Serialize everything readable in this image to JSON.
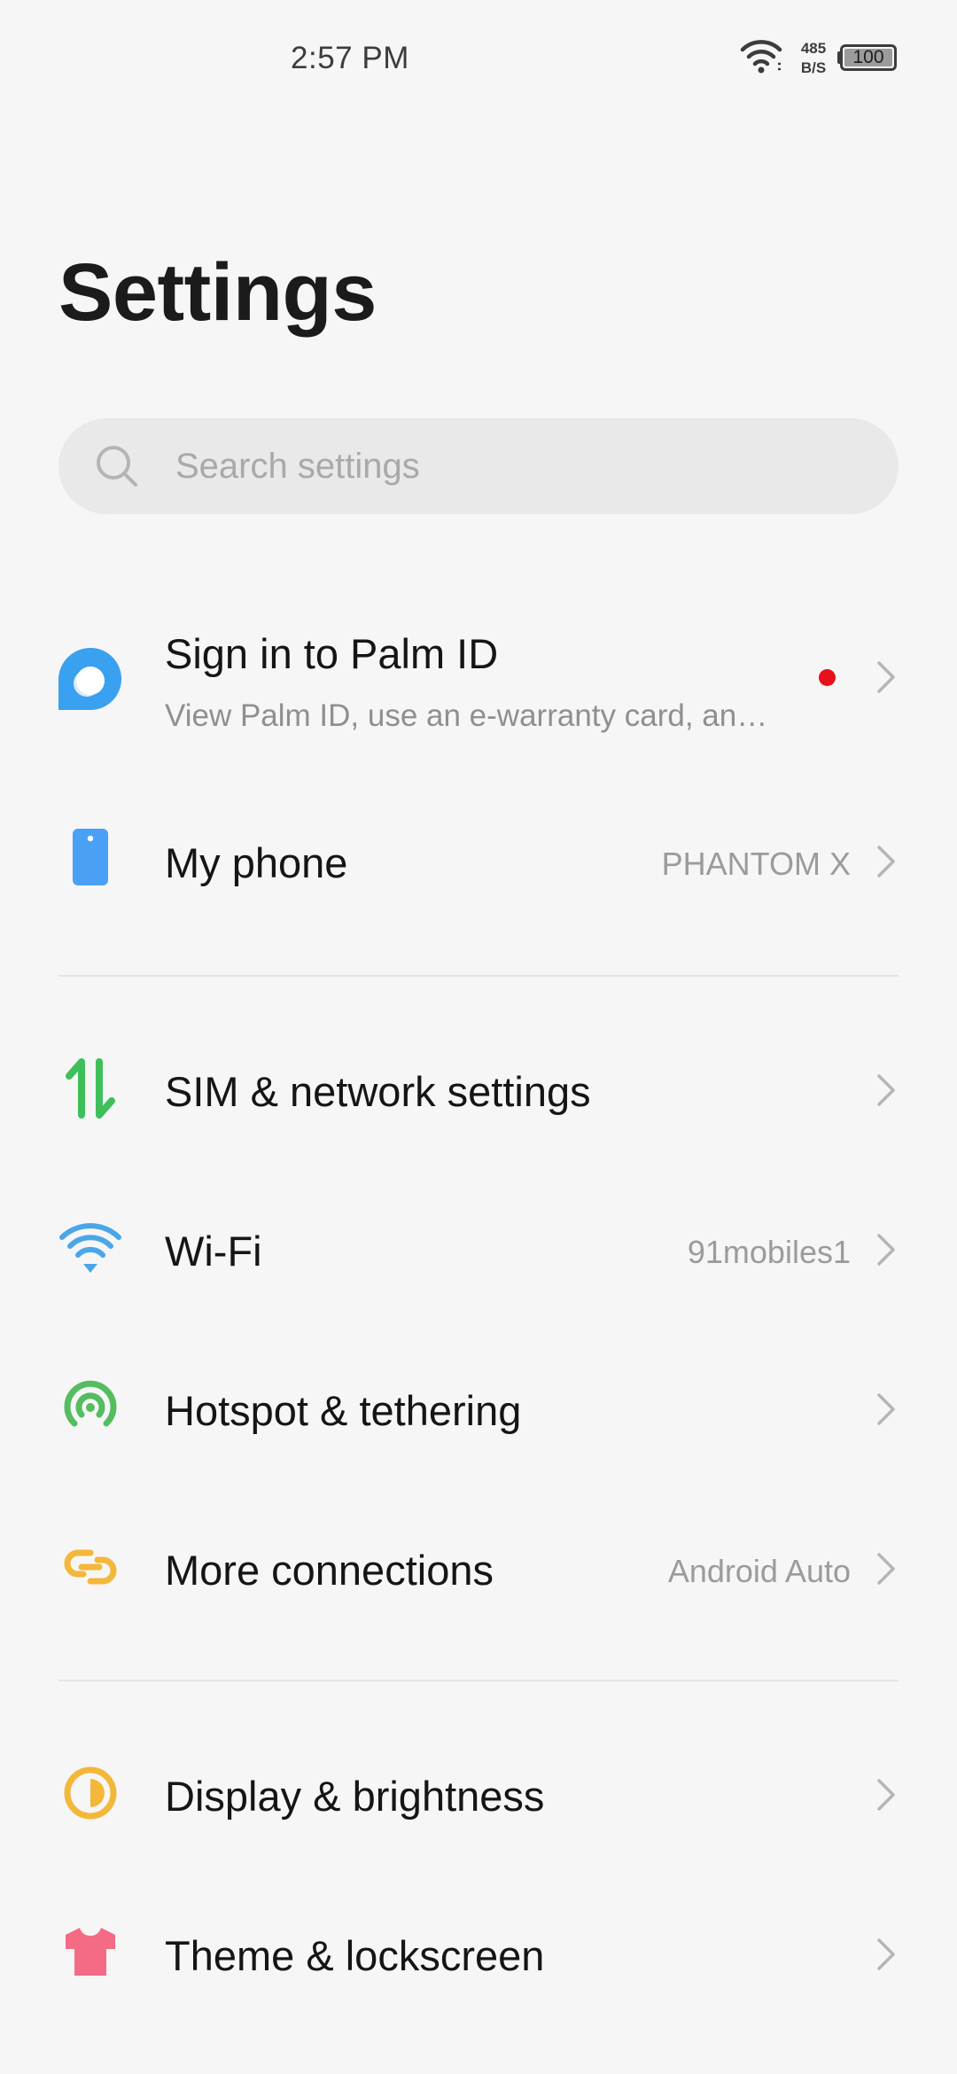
{
  "status_bar": {
    "time": "2:57 PM",
    "net_speed_value": "485",
    "net_speed_unit": "B/S",
    "battery_level": "100"
  },
  "page_title": "Settings",
  "search": {
    "placeholder": "Search settings"
  },
  "items": [
    {
      "title": "Sign in to Palm ID",
      "subtitle": "View Palm ID, use an e-warranty card, an…",
      "value": "",
      "icon": "palm-id-icon",
      "has_badge": true
    },
    {
      "title": "My phone",
      "value": "PHANTOM X",
      "icon": "phone-icon"
    },
    {
      "title": "SIM & network settings",
      "value": "",
      "icon": "sim-network-icon"
    },
    {
      "title": "Wi-Fi",
      "value": "91mobiles1",
      "icon": "wifi-icon"
    },
    {
      "title": "Hotspot & tethering",
      "value": "",
      "icon": "hotspot-icon"
    },
    {
      "title": "More connections",
      "value": "Android Auto",
      "icon": "connections-icon"
    },
    {
      "title": "Display & brightness",
      "value": "",
      "icon": "brightness-icon"
    },
    {
      "title": "Theme & lockscreen",
      "value": "",
      "icon": "theme-shirt-icon"
    }
  ],
  "colors": {
    "background": "#f6f6f6",
    "search_bg": "#e9e9e9",
    "palm_blue": "#3aa0f0",
    "phone_blue": "#4aa0f5",
    "sim_green": "#3fbf5a",
    "wifi_blue": "#4ba6e8",
    "hotspot_green": "#55bd5f",
    "connections_yellow": "#f3b73a",
    "brightness_yellow": "#f3b73a",
    "theme_pink": "#f46b86",
    "badge_red": "#e8101b"
  }
}
